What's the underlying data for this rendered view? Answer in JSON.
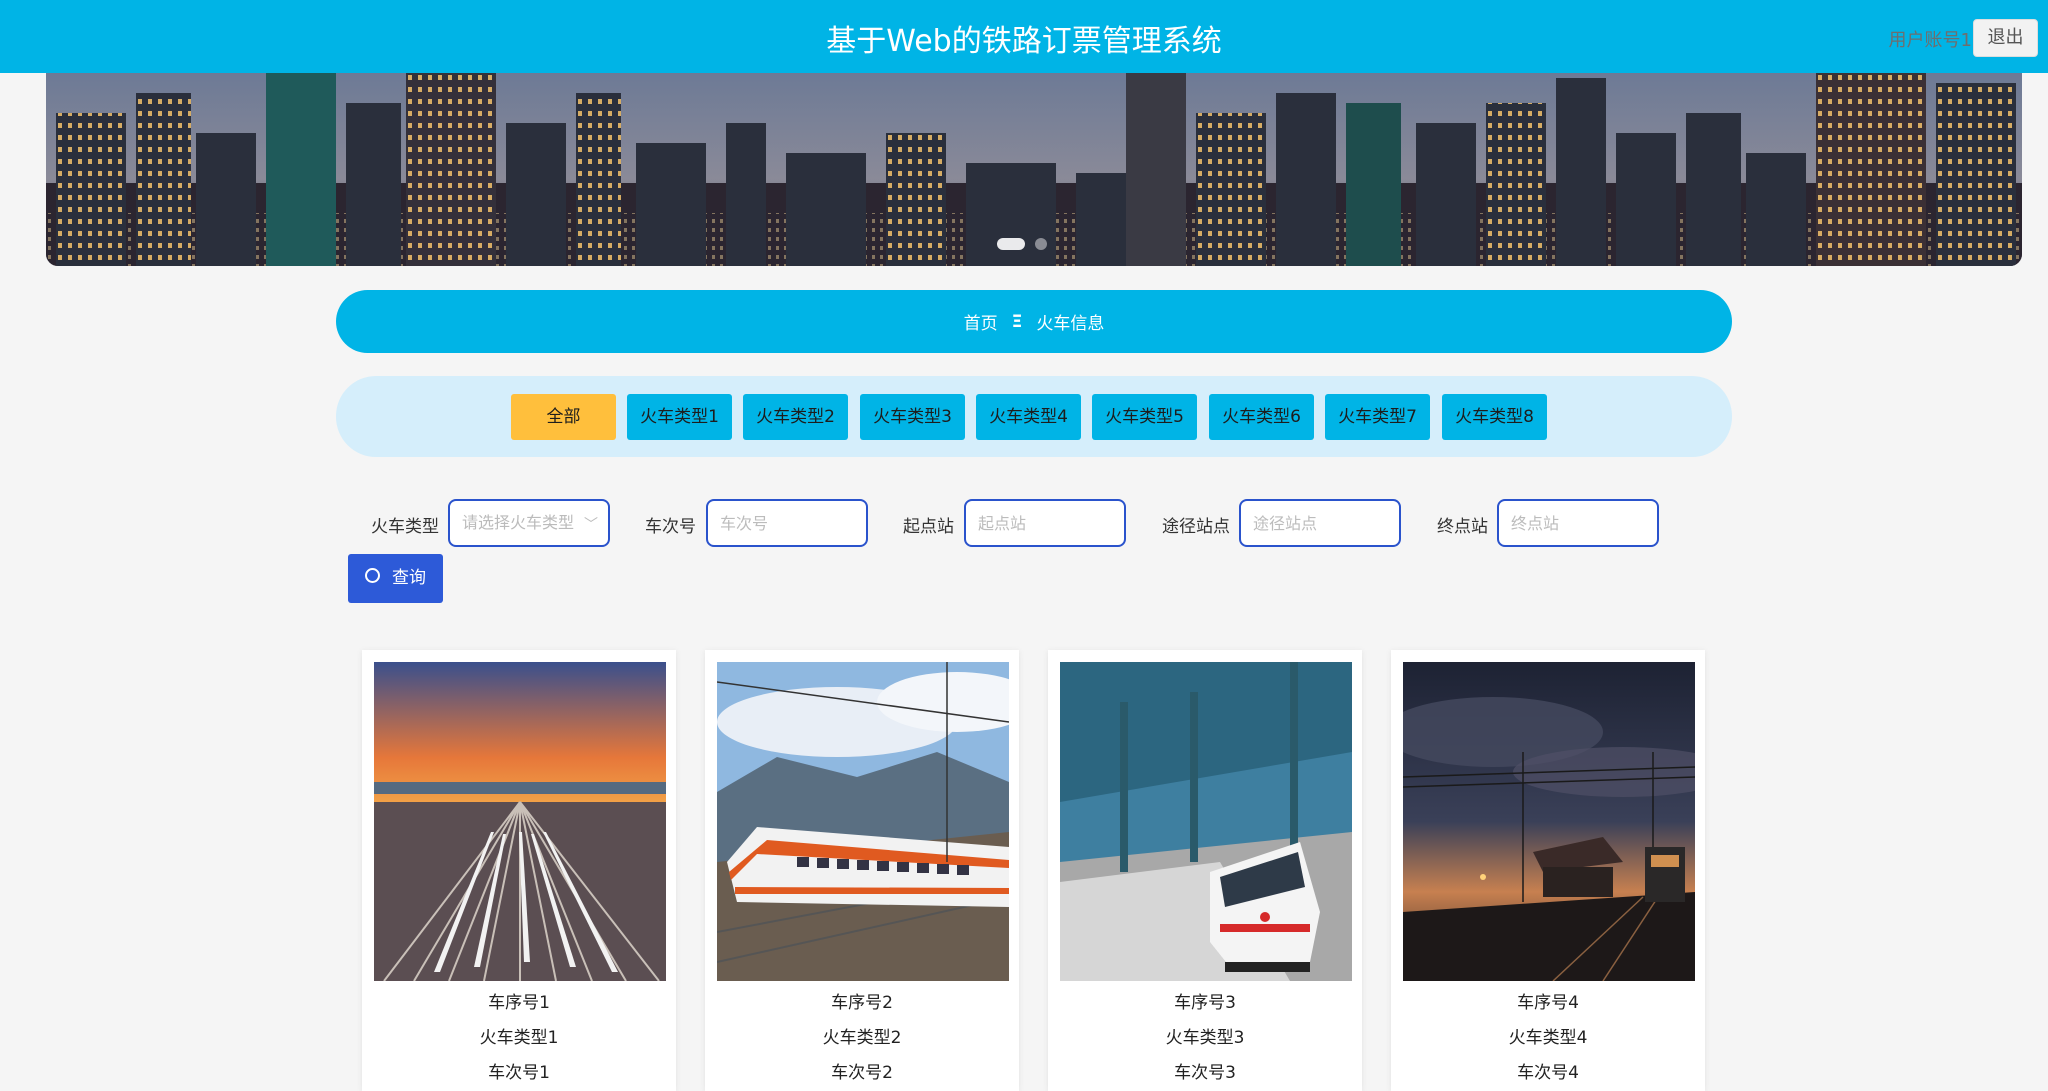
{
  "header": {
    "title": "基于Web的铁路订票管理系统",
    "account": "用户账号1",
    "logout_label": "退出"
  },
  "breadcrumb": {
    "home": "首页",
    "separator": "Ξ",
    "current": "火车信息"
  },
  "categories": [
    {
      "label": "全部",
      "active": true
    },
    {
      "label": "火车类型1"
    },
    {
      "label": "火车类型2"
    },
    {
      "label": "火车类型3"
    },
    {
      "label": "火车类型4"
    },
    {
      "label": "火车类型5"
    },
    {
      "label": "火车类型6"
    },
    {
      "label": "火车类型7"
    },
    {
      "label": "火车类型8"
    }
  ],
  "filters": {
    "train_type_label": "火车类型",
    "train_type_placeholder": "请选择火车类型",
    "train_no_label": "车次号",
    "train_no_placeholder": "车次号",
    "start_label": "起点站",
    "start_placeholder": "起点站",
    "via_label": "途径站点",
    "via_placeholder": "途径站点",
    "end_label": "终点站",
    "end_placeholder": "终点站",
    "query_label": "查询"
  },
  "cards": [
    {
      "seq": "车序号1",
      "type": "火车类型1",
      "train_no": "车次号1"
    },
    {
      "seq": "车序号2",
      "type": "火车类型2",
      "train_no": "车次号2"
    },
    {
      "seq": "车序号3",
      "type": "火车类型3",
      "train_no": "车次号3"
    },
    {
      "seq": "车序号4",
      "type": "火车类型4",
      "train_no": "车次号4"
    }
  ],
  "colors": {
    "primary": "#00b4e6",
    "active_category": "#ffbf3c",
    "query_button": "#2d5ad8",
    "category_bar": "#d5eefb"
  },
  "icons": {
    "query": "search-icon",
    "select": "chevron-down-icon"
  }
}
